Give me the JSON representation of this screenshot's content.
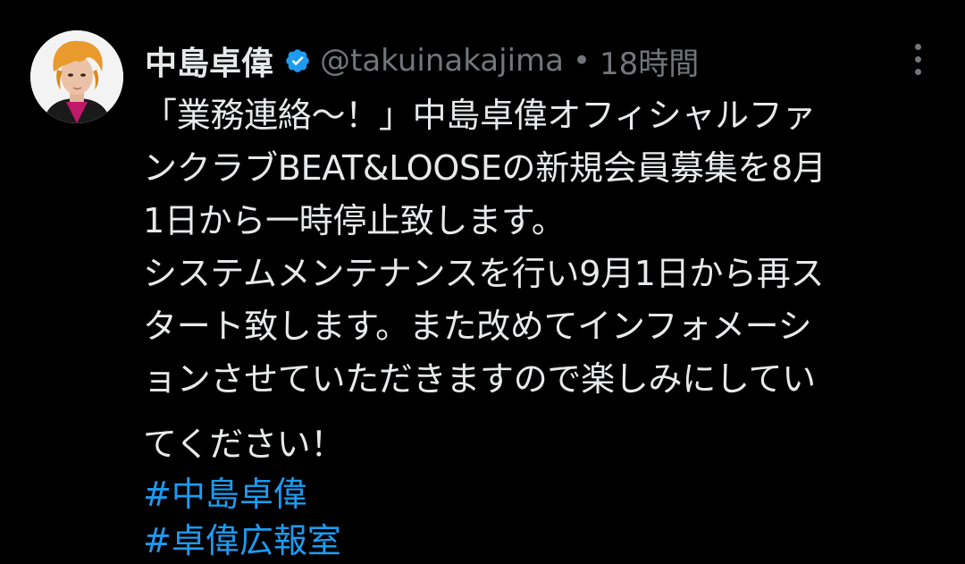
{
  "author": {
    "name": "中島卓偉",
    "handle": "@takuinakajima",
    "separator": "•",
    "time": "18時間"
  },
  "tweet": {
    "lines": [
      "「業務連絡〜！」中島卓偉オフィシャルファ",
      "ンクラブBEAT&LOOSEの新規会員募集を8月",
      "1日から一時停止致します。",
      "システムメンテナンスを行い9月1日から再ス",
      "タート致します。また改めてインフォメーシ",
      "ョンさせていただきますので楽しみにしてい",
      "てください！"
    ],
    "hashtags": [
      "#中島卓偉",
      "#卓偉広報室"
    ]
  },
  "colors": {
    "background": "#000000",
    "text": "#e7e9ea",
    "muted": "#71767b",
    "link": "#1d9bf0",
    "verified": "#1d9bf0"
  }
}
